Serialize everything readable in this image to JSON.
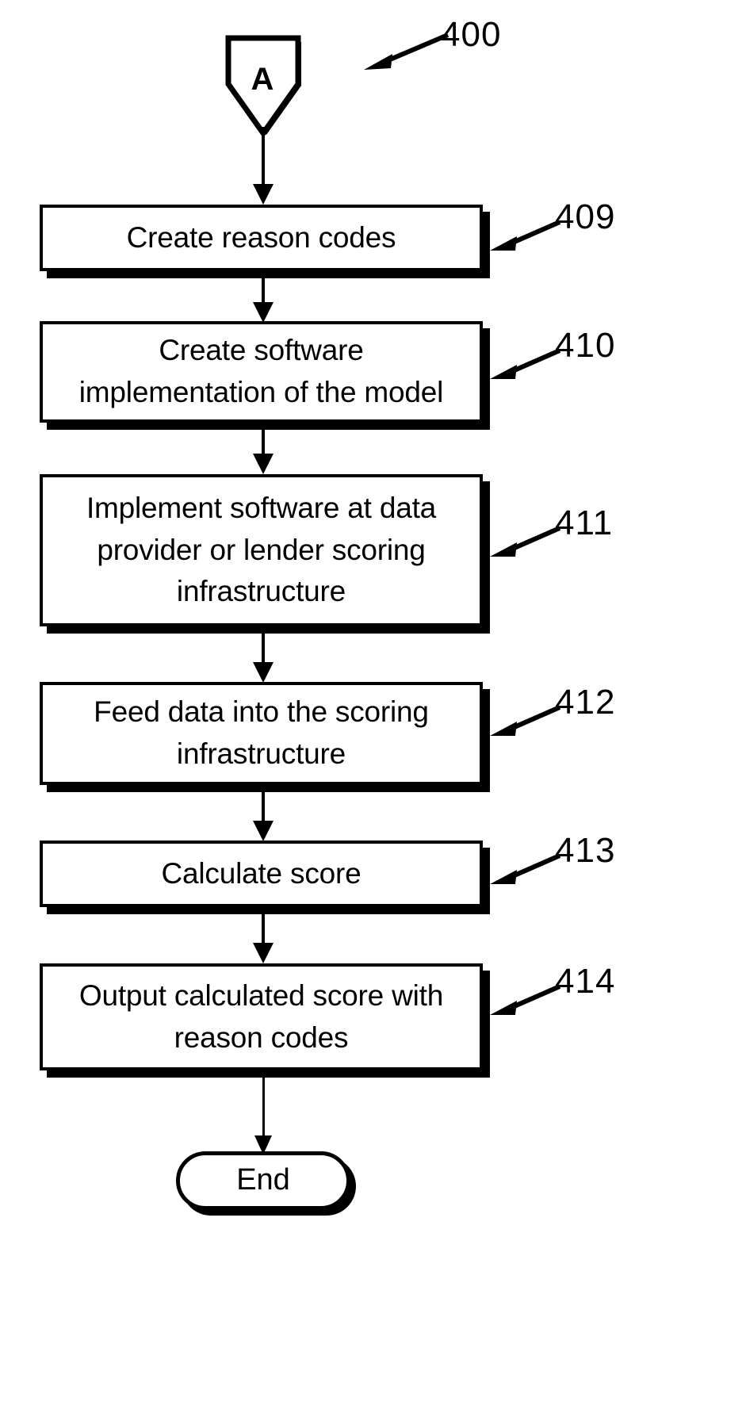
{
  "figure": {
    "number": "400",
    "type": "patent-flowchart"
  },
  "connector": {
    "label": "A",
    "shape": "home-plate-pentagon"
  },
  "steps": [
    {
      "ref": "409",
      "text": "Create reason codes"
    },
    {
      "ref": "410",
      "text": "Create software\nimplementation of the model"
    },
    {
      "ref": "411",
      "text": "Implement software at data\nprovider or lender scoring\ninfrastructure"
    },
    {
      "ref": "412",
      "text": "Feed data into the scoring\ninfrastructure"
    },
    {
      "ref": "413",
      "text": "Calculate score"
    },
    {
      "ref": "414",
      "text": "Output calculated score with\nreason codes"
    }
  ],
  "terminator": {
    "label": "End"
  },
  "colors": {
    "ink": "#000000",
    "paper": "#ffffff"
  },
  "icons": {
    "arrow": "down-arrow-icon",
    "leader": "leader-line-arrow-icon"
  }
}
